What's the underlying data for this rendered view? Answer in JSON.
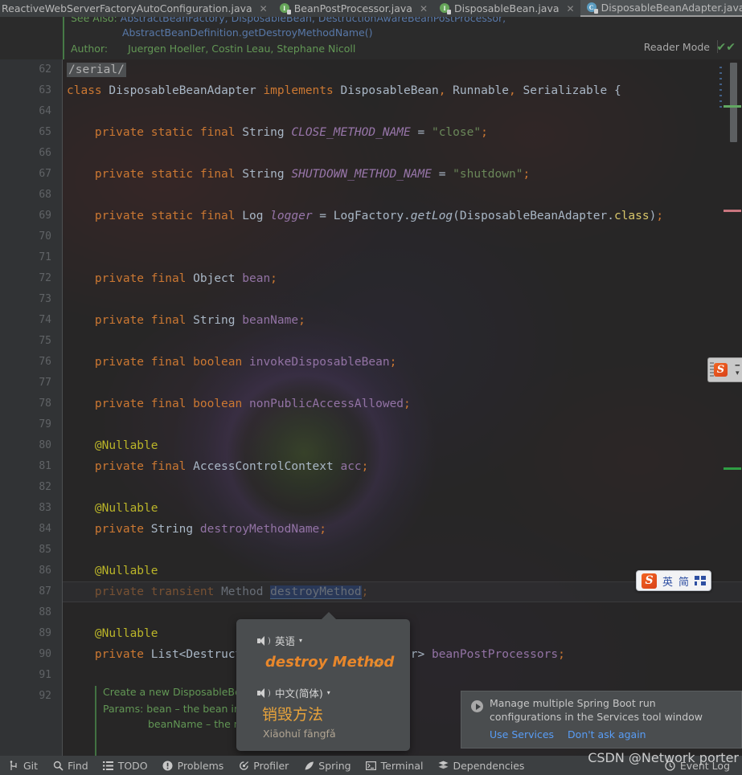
{
  "tabs": [
    {
      "label": "ReactiveWebServerFactoryAutoConfiguration.java",
      "icon": "java-class-icon",
      "active": false,
      "closable": true
    },
    {
      "label": "BeanPostProcessor.java",
      "icon": "java-interface-icon",
      "active": false,
      "closable": true
    },
    {
      "label": "DisposableBean.java",
      "icon": "java-interface-icon",
      "active": false,
      "closable": true
    },
    {
      "label": "DisposableBeanAdapter.java",
      "icon": "java-class-icon",
      "active": true,
      "closable": true
    }
  ],
  "tabbar": {
    "overflow_label": "⌄"
  },
  "javadoc_header": {
    "see_also_label": "See Also:",
    "see_also_links": "AbstractBeanFactory, DisposableBean, DestructionAwareBeanPostProcessor,",
    "see_also_link2": "AbstractBeanDefinition.getDestroyMethodName()",
    "author_label": "Author:",
    "author_value": "Juergen Hoeller, Costin Leau, Stephane Nicoll",
    "reader_mode_label": "Reader Mode",
    "reader_mode_check": "✔✔"
  },
  "editor": {
    "first_line_number": 62,
    "current_line": 87,
    "selected_token": "destroyMethod",
    "lines": [
      {
        "n": 62,
        "segments": [
          {
            "t": "/serial/",
            "c": "serialbox"
          }
        ]
      },
      {
        "n": 63,
        "segments": [
          {
            "t": "class ",
            "c": "kw"
          },
          {
            "t": "DisposableBeanAdapter ",
            "c": "type"
          },
          {
            "t": "implements ",
            "c": "kw"
          },
          {
            "t": "DisposableBean",
            "c": "type"
          },
          {
            "t": ", ",
            "c": "pun"
          },
          {
            "t": "Runnable",
            "c": "type"
          },
          {
            "t": ", ",
            "c": "pun"
          },
          {
            "t": "Serializable ",
            "c": "type"
          },
          {
            "t": "{",
            "c": "type"
          }
        ]
      },
      {
        "n": 64,
        "segments": []
      },
      {
        "n": 65,
        "segments": [
          {
            "t": "    ",
            "c": ""
          },
          {
            "t": "private static final ",
            "c": "kw"
          },
          {
            "t": "String ",
            "c": "type"
          },
          {
            "t": "CLOSE_METHOD_NAME ",
            "c": "cst"
          },
          {
            "t": "= ",
            "c": "type"
          },
          {
            "t": "\"close\"",
            "c": "str"
          },
          {
            "t": ";",
            "c": "pun"
          }
        ]
      },
      {
        "n": 66,
        "segments": []
      },
      {
        "n": 67,
        "segments": [
          {
            "t": "    ",
            "c": ""
          },
          {
            "t": "private static final ",
            "c": "kw"
          },
          {
            "t": "String ",
            "c": "type"
          },
          {
            "t": "SHUTDOWN_METHOD_NAME ",
            "c": "cst"
          },
          {
            "t": "= ",
            "c": "type"
          },
          {
            "t": "\"shutdown\"",
            "c": "str"
          },
          {
            "t": ";",
            "c": "pun"
          }
        ]
      },
      {
        "n": 68,
        "segments": []
      },
      {
        "n": 69,
        "segments": [
          {
            "t": "    ",
            "c": ""
          },
          {
            "t": "private static final ",
            "c": "kw"
          },
          {
            "t": "Log ",
            "c": "type"
          },
          {
            "t": "logger ",
            "c": "cst"
          },
          {
            "t": "= ",
            "c": "type"
          },
          {
            "t": "LogFactory.",
            "c": "type"
          },
          {
            "t": "getLog",
            "c": "mth"
          },
          {
            "t": "(DisposableBeanAdapter.",
            "c": "type"
          },
          {
            "t": "class",
            "c": "clsy"
          },
          {
            "t": ")",
            "c": "type"
          },
          {
            "t": ";",
            "c": "pun"
          }
        ]
      },
      {
        "n": 70,
        "segments": []
      },
      {
        "n": 71,
        "segments": []
      },
      {
        "n": 72,
        "segments": [
          {
            "t": "    ",
            "c": ""
          },
          {
            "t": "private final ",
            "c": "kw"
          },
          {
            "t": "Object ",
            "c": "type"
          },
          {
            "t": "bean",
            "c": "fld"
          },
          {
            "t": ";",
            "c": "pun"
          }
        ]
      },
      {
        "n": 73,
        "segments": []
      },
      {
        "n": 74,
        "segments": [
          {
            "t": "    ",
            "c": ""
          },
          {
            "t": "private final ",
            "c": "kw"
          },
          {
            "t": "String ",
            "c": "type"
          },
          {
            "t": "beanName",
            "c": "fld"
          },
          {
            "t": ";",
            "c": "pun"
          }
        ]
      },
      {
        "n": 75,
        "segments": []
      },
      {
        "n": 76,
        "segments": [
          {
            "t": "    ",
            "c": ""
          },
          {
            "t": "private final boolean ",
            "c": "kw"
          },
          {
            "t": "invokeDisposableBean",
            "c": "fld"
          },
          {
            "t": ";",
            "c": "pun"
          }
        ]
      },
      {
        "n": 77,
        "segments": []
      },
      {
        "n": 78,
        "segments": [
          {
            "t": "    ",
            "c": ""
          },
          {
            "t": "private final boolean ",
            "c": "kw"
          },
          {
            "t": "nonPublicAccessAllowed",
            "c": "fld"
          },
          {
            "t": ";",
            "c": "pun"
          }
        ]
      },
      {
        "n": 79,
        "segments": []
      },
      {
        "n": 80,
        "segments": [
          {
            "t": "    ",
            "c": ""
          },
          {
            "t": "@Nullable",
            "c": "ann"
          }
        ]
      },
      {
        "n": 81,
        "segments": [
          {
            "t": "    ",
            "c": ""
          },
          {
            "t": "private final ",
            "c": "kw"
          },
          {
            "t": "AccessControlContext ",
            "c": "type"
          },
          {
            "t": "acc",
            "c": "fld"
          },
          {
            "t": ";",
            "c": "pun"
          }
        ]
      },
      {
        "n": 82,
        "segments": []
      },
      {
        "n": 83,
        "segments": [
          {
            "t": "    ",
            "c": ""
          },
          {
            "t": "@Nullable",
            "c": "ann"
          }
        ]
      },
      {
        "n": 84,
        "segments": [
          {
            "t": "    ",
            "c": ""
          },
          {
            "t": "private ",
            "c": "kw"
          },
          {
            "t": "String ",
            "c": "type"
          },
          {
            "t": "destroyMethodName",
            "c": "fld"
          },
          {
            "t": ";",
            "c": "pun"
          }
        ]
      },
      {
        "n": 85,
        "segments": []
      },
      {
        "n": 86,
        "segments": [
          {
            "t": "    ",
            "c": ""
          },
          {
            "t": "@Nullable",
            "c": "ann"
          }
        ]
      },
      {
        "n": 87,
        "segments": [
          {
            "t": "    ",
            "c": ""
          },
          {
            "t": "private transient ",
            "c": "kw"
          },
          {
            "t": "Method ",
            "c": "type"
          },
          {
            "t": "destroyMethod",
            "c": "selhl"
          },
          {
            "t": ";",
            "c": "pun"
          }
        ]
      },
      {
        "n": 88,
        "segments": []
      },
      {
        "n": 89,
        "segments": [
          {
            "t": "    ",
            "c": ""
          },
          {
            "t": "@Nullable",
            "c": "ann"
          }
        ]
      },
      {
        "n": 90,
        "segments": [
          {
            "t": "    ",
            "c": ""
          },
          {
            "t": "private ",
            "c": "kw"
          },
          {
            "t": "List<DestructionAwareBeanPostProcessor> ",
            "c": "type"
          },
          {
            "t": "beanPostProcessors",
            "c": "fld"
          },
          {
            "t": ";",
            "c": "pun"
          }
        ]
      },
      {
        "n": 91,
        "segments": []
      },
      {
        "n": 92,
        "segments": []
      }
    ]
  },
  "javadoc_bottom": {
    "line1": "Create a new DisposableBeanAdapter for the given bean.",
    "line2": "Params: bean – the bean instance (never null)",
    "line3": "beanName – the name of the bean"
  },
  "translation_popup": {
    "source_lang": "英语",
    "source_text": "destroy Method",
    "target_lang": "中文(简体)",
    "target_text": "销毁方法",
    "pinyin": "Xiāohuǐ fāngfǎ",
    "caret": "▾",
    "star": "☆"
  },
  "notification": {
    "message": "Manage multiple Spring Boot run configurations in the Services tool window",
    "action_primary": "Use Services",
    "action_secondary": "Don't ask again"
  },
  "ime_bar": {
    "logo": "S",
    "mode_label": "英",
    "shape_label": "简"
  },
  "sogou_edge": {
    "logo": "S",
    "caret": "▾"
  },
  "watermark": "CSDN @Network porter",
  "statusbar": {
    "items": [
      {
        "label": "Git",
        "icon": "git-branch-icon"
      },
      {
        "label": "Find",
        "icon": "search-icon"
      },
      {
        "label": "TODO",
        "icon": "list-icon"
      },
      {
        "label": "Problems",
        "icon": "warning-icon"
      },
      {
        "label": "Profiler",
        "icon": "profiler-icon"
      },
      {
        "label": "Spring",
        "icon": "spring-leaf-icon"
      },
      {
        "label": "Terminal",
        "icon": "terminal-icon"
      },
      {
        "label": "Dependencies",
        "icon": "dependencies-icon"
      }
    ],
    "right": {
      "label": "Event Log",
      "icon": "event-log-icon"
    }
  },
  "colors": {
    "accent_orange": "#e8872b",
    "link_blue": "#589df6",
    "selection_blue": "#214283",
    "keyword_orange": "#cc7832",
    "string_green": "#6a8759",
    "javadoc_green": "#629755",
    "annotation_yellow": "#bbb529"
  }
}
